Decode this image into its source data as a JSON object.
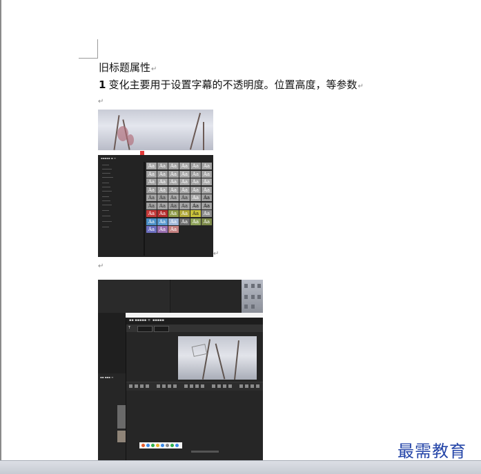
{
  "document": {
    "heading": "旧标题属性",
    "paragraph_number": "1",
    "paragraph_text": "变化主要用于设置字幕的不透明度。位置高度，等参数",
    "paragraph_mark": "↵"
  },
  "image1": {
    "style_tile_label": "Aa",
    "tile_colors": [
      "#a8a8a8",
      "#9a9a9a",
      "#a2a2a2",
      "#a5a5a5",
      "#9d9d9d",
      "#a0a0a0",
      "#a6a6a6",
      "#9f9f9f",
      "#a3a3a3",
      "#a9a9a9",
      "#9b9b9b",
      "#a4a4a4",
      "#9e9e9e",
      "#a7a7a7",
      "#a1a1a1",
      "#a5a5a5",
      "#9c9c9c",
      "#a8a8a8",
      "#9a9a9a",
      "#a6a6a6",
      "#a0a0a0",
      "#a3a3a3",
      "#9f9f9f",
      "#a2a2a2",
      "#a4a4a4",
      "#9d9d9d",
      "#a9a9a9",
      "#a1a1a1",
      "#a7a7a7",
      "#9e9e9e",
      "#a0a0a0",
      "#a5a5a5",
      "#9c9c9c",
      "#a3a3a3",
      "#a8a8a8",
      "#a2a2a2",
      "#c43a3a",
      "#b52f2f",
      "#8f9a4a",
      "#b0a73a",
      "#c9c23a",
      "#8c8c8c",
      "#4a8fc7",
      "#5a9ad0",
      "#9fb7d9",
      "#6f6f6f",
      "#8ea25a",
      "#7d8a4a",
      "#6c6fc0",
      "#9a6fb0",
      "#c48080"
    ],
    "tile_text_colors": [
      "#ffffff",
      "#ffffff",
      "#ffffff",
      "#ffffff",
      "#ffffff",
      "#ffffff",
      "#ffffff",
      "#ffffff",
      "#ffffff",
      "#ffffff",
      "#ffffff",
      "#ffffff",
      "#ffffff",
      "#ffffff",
      "#ffffff",
      "#ffffff",
      "#ffffff",
      "#ffffff",
      "#ffffff",
      "#ffffff",
      "#ffffff",
      "#ffffff",
      "#ffffff",
      "#ffffff",
      "#333333",
      "#333333",
      "#333333",
      "#333333",
      "#ffffff",
      "#111111",
      "#333333",
      "#333333",
      "#333333",
      "#333333",
      "#111111",
      "#111111",
      "#ffffff",
      "#ffffff",
      "#ffffff",
      "#ffffff",
      "#222222",
      "#ffffff",
      "#ffffff",
      "#ffffff",
      "#ffffff",
      "#ffffff",
      "#ffffff",
      "#ffffff",
      "#ffffff",
      "#ffffff",
      "#ffffff"
    ]
  },
  "image2": {
    "taskbar_colors": [
      "#e85c2a",
      "#3a8be8",
      "#2bb24c",
      "#e8b12a",
      "#3a8be8",
      "#888888",
      "#2bb24c",
      "#3a8be8"
    ]
  },
  "watermark": {
    "text": "最需教育",
    "color": "#2445a8"
  }
}
